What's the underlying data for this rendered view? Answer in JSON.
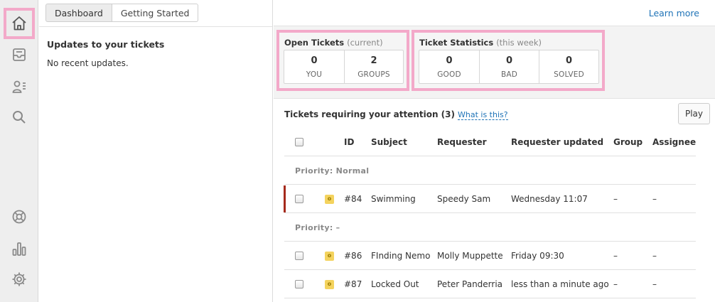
{
  "nav": {
    "items": [
      {
        "icon": "home-icon",
        "active": true
      },
      {
        "icon": "inbox-icon"
      },
      {
        "icon": "users-icon"
      },
      {
        "icon": "search-icon"
      },
      {
        "icon": "help-ring-icon"
      },
      {
        "icon": "reporting-icon"
      },
      {
        "icon": "gear-icon"
      }
    ]
  },
  "tabs": [
    "Dashboard",
    "Getting Started"
  ],
  "updates": {
    "title": "Updates to your tickets",
    "empty": "No recent updates."
  },
  "topbar": {
    "learn_more": "Learn more"
  },
  "open_tickets": {
    "title": "Open Tickets",
    "subtitle": "(current)",
    "stats": [
      {
        "value": "0",
        "label": "YOU"
      },
      {
        "value": "2",
        "label": "GROUPS"
      }
    ]
  },
  "ticket_statistics": {
    "title": "Ticket Statistics",
    "subtitle": "(this week)",
    "stats": [
      {
        "value": "0",
        "label": "GOOD"
      },
      {
        "value": "0",
        "label": "BAD"
      },
      {
        "value": "0",
        "label": "SOLVED"
      }
    ]
  },
  "tickets": {
    "heading": "Tickets requiring your attention (3)",
    "whats_this": "What is this?",
    "play": "Play",
    "columns": [
      "ID",
      "Subject",
      "Requester",
      "Requester updated",
      "Group",
      "Assignee"
    ],
    "groups": [
      {
        "label": "Priority: Normal",
        "rows": [
          {
            "status": "o",
            "id": "#84",
            "subject": "Swimming",
            "requester": "Speedy Sam",
            "updated": "Wednesday 11:07",
            "group": "–",
            "assignee": "–"
          }
        ]
      },
      {
        "label": "Priority: –",
        "rows": [
          {
            "status": "o",
            "id": "#86",
            "subject": "FInding Nemo",
            "requester": "Molly Muppette",
            "updated": "Friday 09:30",
            "group": "–",
            "assignee": "–"
          },
          {
            "status": "o",
            "id": "#87",
            "subject": "Locked Out",
            "requester": "Peter Panderria",
            "updated": "less than a minute ago",
            "group": "–",
            "assignee": "–"
          }
        ]
      }
    ]
  },
  "colors": {
    "highlight": "#f3a9c9",
    "link": "#1f73b7",
    "priority_bar": "#a52a1c",
    "status_new": "#f4d35e"
  }
}
